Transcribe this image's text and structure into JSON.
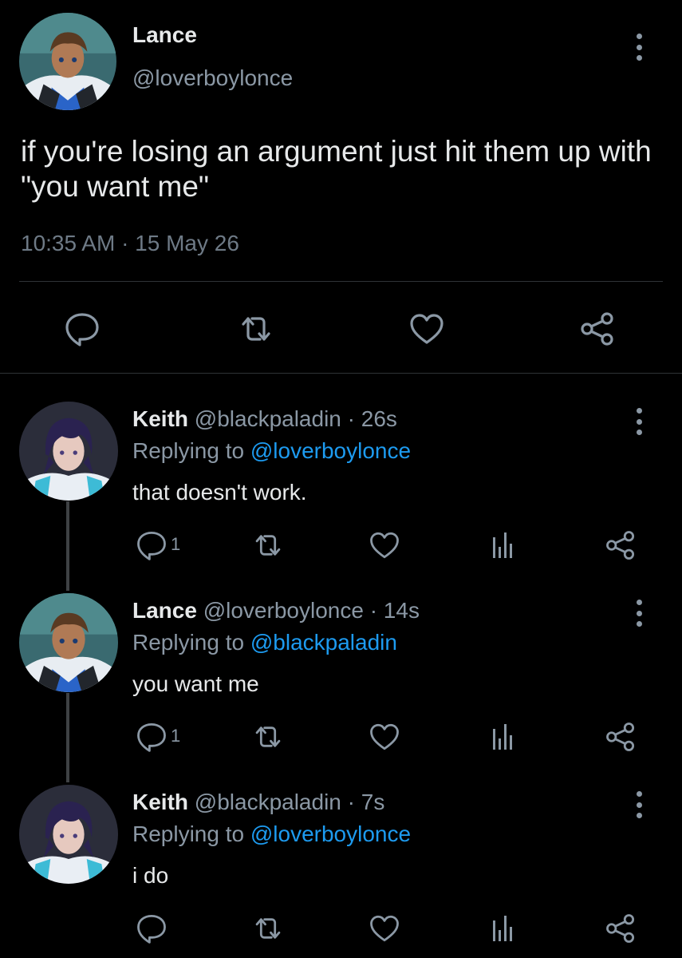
{
  "main_tweet": {
    "name": "Lance",
    "handle": "@loverboylonce",
    "text": "if you're losing an argument just hit them up with \"you want me\"",
    "timestamp": "10:35 AM · 15 May 26",
    "actions": [
      "reply-icon",
      "retweet-icon",
      "like-icon",
      "share-icon"
    ]
  },
  "replies": [
    {
      "name": "Keith",
      "meta": " @blackpaladin · 26s",
      "replying_prefix": "Replying to ",
      "replying_to": "@loverboylonce",
      "text": "that doesn't work.",
      "reply_count": "1"
    },
    {
      "name": "Lance",
      "meta": " @loverboylonce · 14s",
      "replying_prefix": "Replying to ",
      "replying_to": "@blackpaladin",
      "text": "you want me",
      "reply_count": "1"
    },
    {
      "name": "Keith",
      "meta": " @blackpaladin · 7s",
      "replying_prefix": "Replying to ",
      "replying_to": "@loverboylonce",
      "text": "i do",
      "reply_count": ""
    }
  ],
  "colors": {
    "background": "#000000",
    "text": "#e7e9ea",
    "secondary": "#8b98a5",
    "mention": "#1d9bf0",
    "divider": "#2f3336"
  }
}
